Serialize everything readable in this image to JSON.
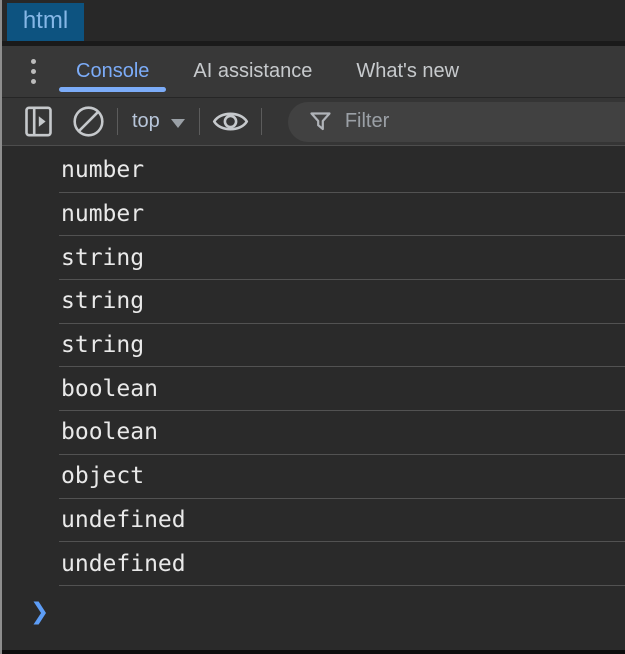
{
  "window": {
    "page_tab_label": "html"
  },
  "colors": {
    "accent_blue": "#7cacf8",
    "prompt_blue": "#5d9df6",
    "page_tab_bg": "#0d5380",
    "page_tab_text": "#85b7e6",
    "toolbar_bg": "#353535",
    "console_bg": "#2a2a2a",
    "divider": "#525252"
  },
  "header": {
    "tabs": [
      {
        "label": "Console",
        "active": true
      },
      {
        "label": "AI assistance",
        "active": false
      },
      {
        "label": "What's new",
        "active": false
      }
    ]
  },
  "toolbar": {
    "context_selector": {
      "label": "top"
    },
    "filter": {
      "placeholder": "Filter",
      "value": ""
    }
  },
  "console": {
    "messages": [
      "number",
      "number",
      "string",
      "string",
      "string",
      "boolean",
      "boolean",
      "object",
      "undefined",
      "undefined"
    ],
    "prompt_symbol": "❯"
  }
}
